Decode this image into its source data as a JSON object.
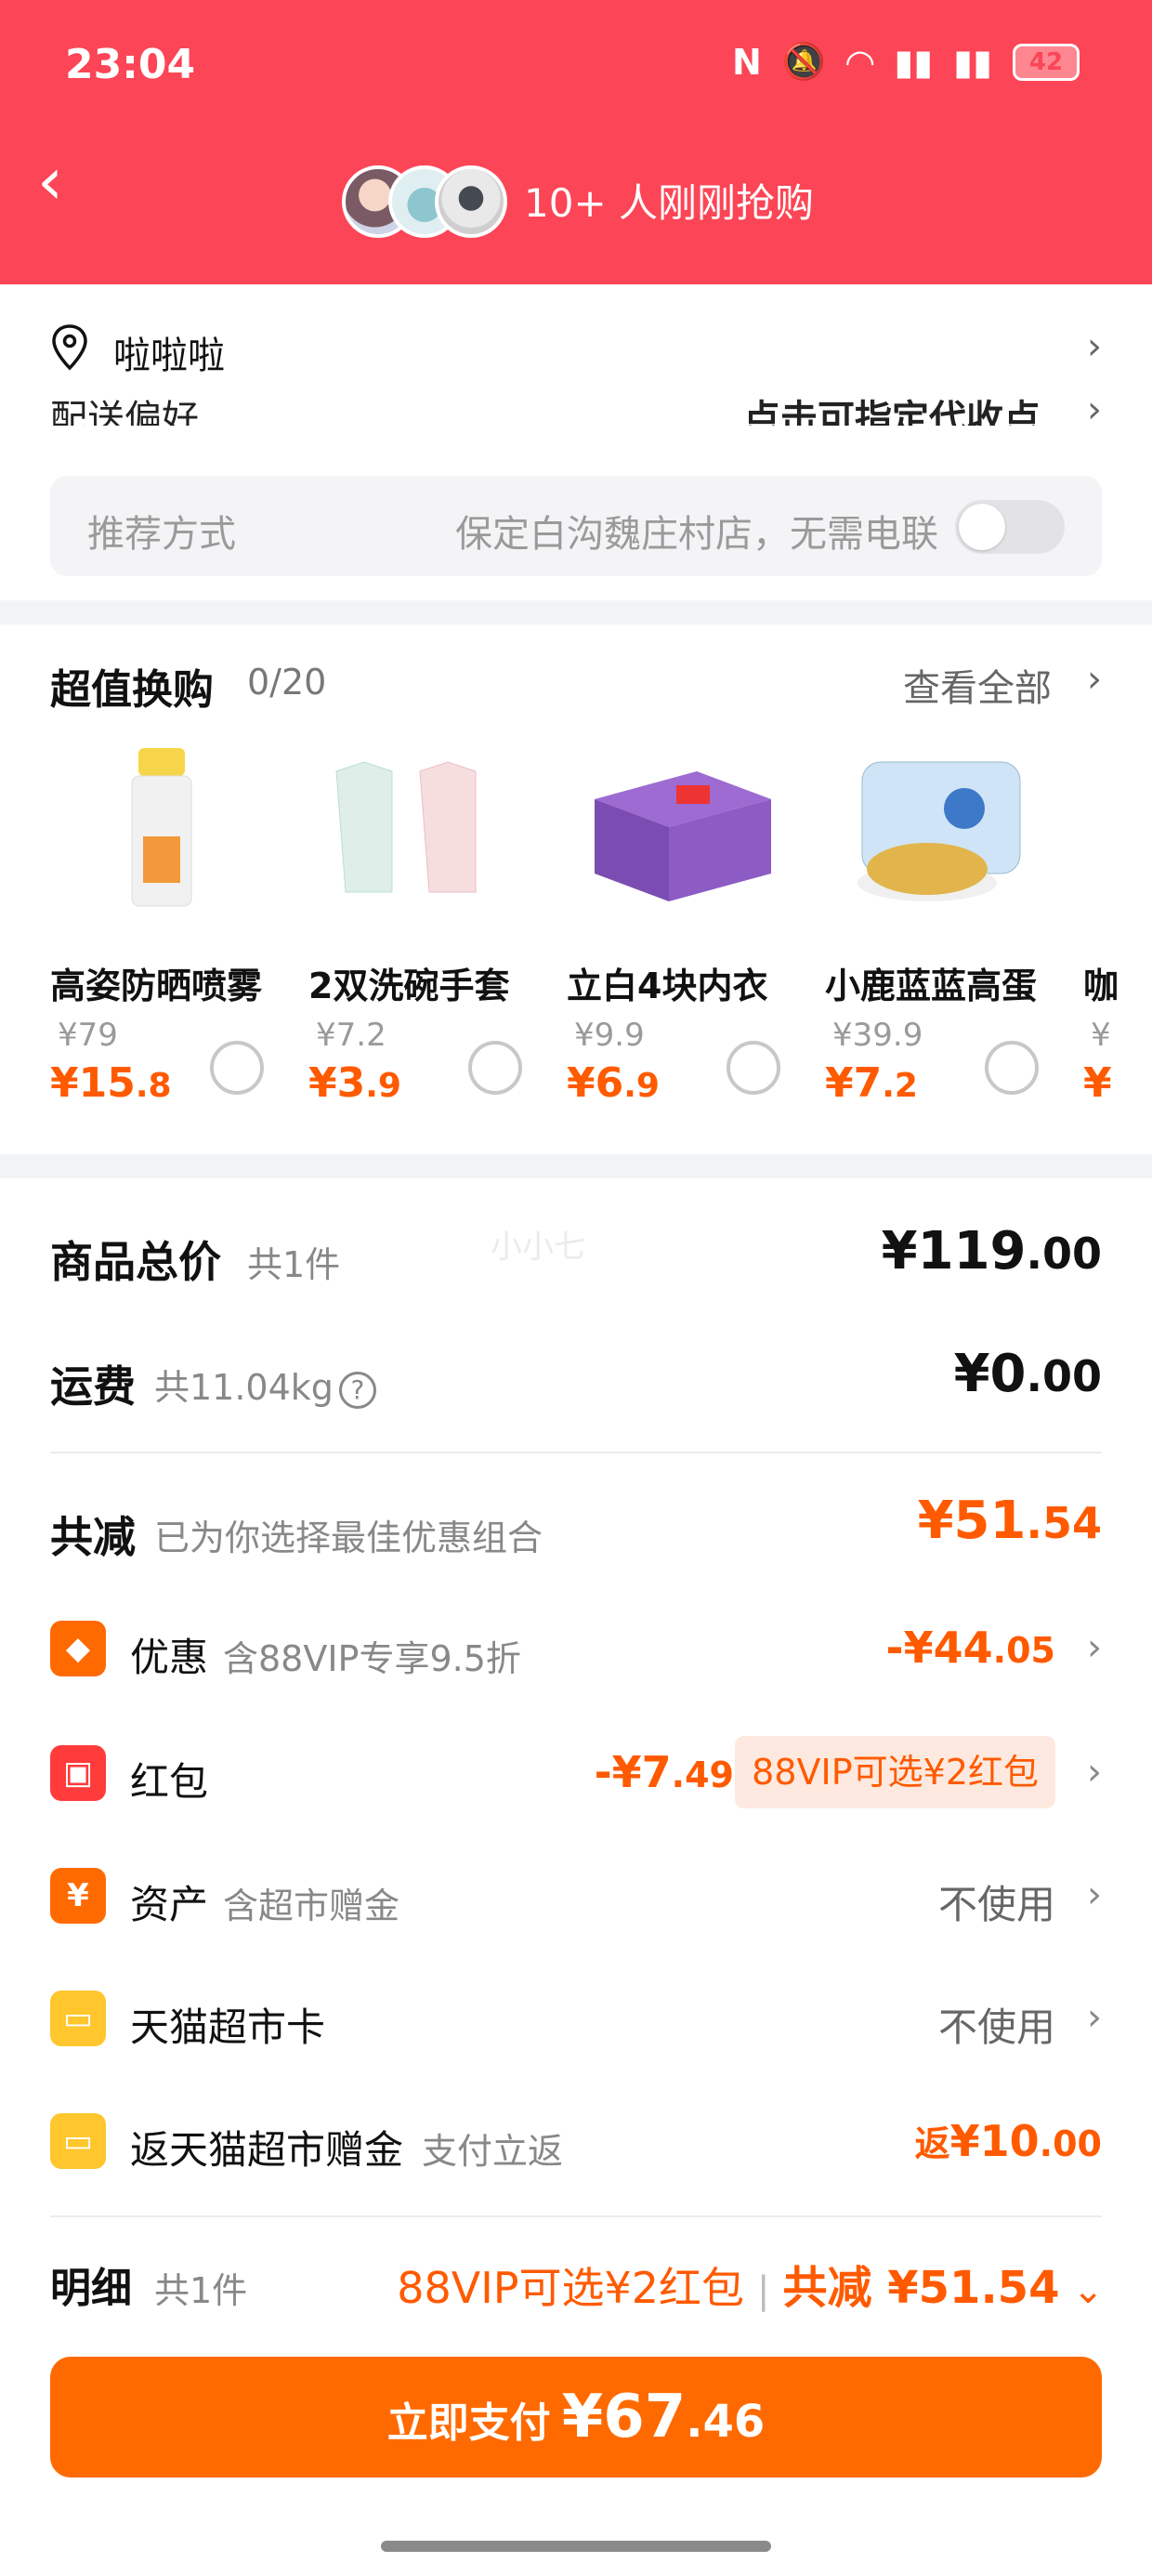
{
  "status_bar": {
    "time": "23:04",
    "battery": "42"
  },
  "header": {
    "social_text": "10+ 人刚刚抢购"
  },
  "address": {
    "name": "啦啦啦",
    "delivery_label": "配送偏好",
    "delivery_value": "点击可指定代收点",
    "recommend_label": "推荐方式",
    "recommend_value": "保定白沟魏庄村店，无需电联"
  },
  "exchange": {
    "title": "超值换购",
    "count": "0/20",
    "view_all": "查看全部",
    "products": [
      {
        "name": "高姿防晒喷雾",
        "orig": "¥79",
        "price_int": "¥15",
        "price_dec": ".8"
      },
      {
        "name": "2双洗碗手套",
        "orig": "¥7.2",
        "price_int": "¥3",
        "price_dec": ".9"
      },
      {
        "name": "立白4块内衣",
        "orig": "¥9.9",
        "price_int": "¥6",
        "price_dec": ".9"
      },
      {
        "name": "小鹿蓝蓝高蛋",
        "orig": "¥39.9",
        "price_int": "¥7",
        "price_dec": ".2"
      },
      {
        "name": "咖",
        "orig": "¥",
        "price_int": "¥",
        "price_dec": ""
      }
    ]
  },
  "summary": {
    "watermark": "小小七",
    "total_label": "商品总价",
    "total_count": "共1件",
    "total_int": "¥119",
    "total_dec": ".00",
    "freight_label": "运费",
    "freight_weight": "共11.04kg",
    "freight_int": "¥0",
    "freight_dec": ".00",
    "reduce_label": "共减",
    "reduce_sub": "已为你选择最佳优惠组合",
    "reduce_int": "¥51",
    "reduce_dec": ".54",
    "discount_label": "优惠",
    "discount_sub": "含88VIP专享9.5折",
    "discount_int": "-¥44",
    "discount_dec": ".05",
    "redpack_label": "红包",
    "redpack_int": "-¥7",
    "redpack_dec": ".49",
    "redpack_tag": "88VIP可选¥2红包",
    "asset_label": "资产",
    "asset_sub": "含超市赠金",
    "asset_value": "不使用",
    "card_label": "天猫超市卡",
    "card_value": "不使用",
    "rebate_label": "返天猫超市赠金",
    "rebate_sub": "支付立返",
    "rebate_prefix": "返",
    "rebate_int": "¥10",
    "rebate_dec": ".00"
  },
  "detail": {
    "title": "明细",
    "count": "共1件",
    "vip_text": "88VIP可选¥2红包",
    "reduce_text": "共减 ¥51.54"
  },
  "pay": {
    "label": "立即支付",
    "amt_int": "¥67",
    "amt_dec": ".46"
  },
  "icons": {
    "discount": "tag-icon",
    "redpack": "red-envelope-icon",
    "asset": "yen-icon",
    "card": "card-icon",
    "rebate": "card-icon"
  },
  "colors": {
    "header": "#fc4556",
    "accent": "#ff5a00",
    "pay_button": "#ff6a00"
  }
}
